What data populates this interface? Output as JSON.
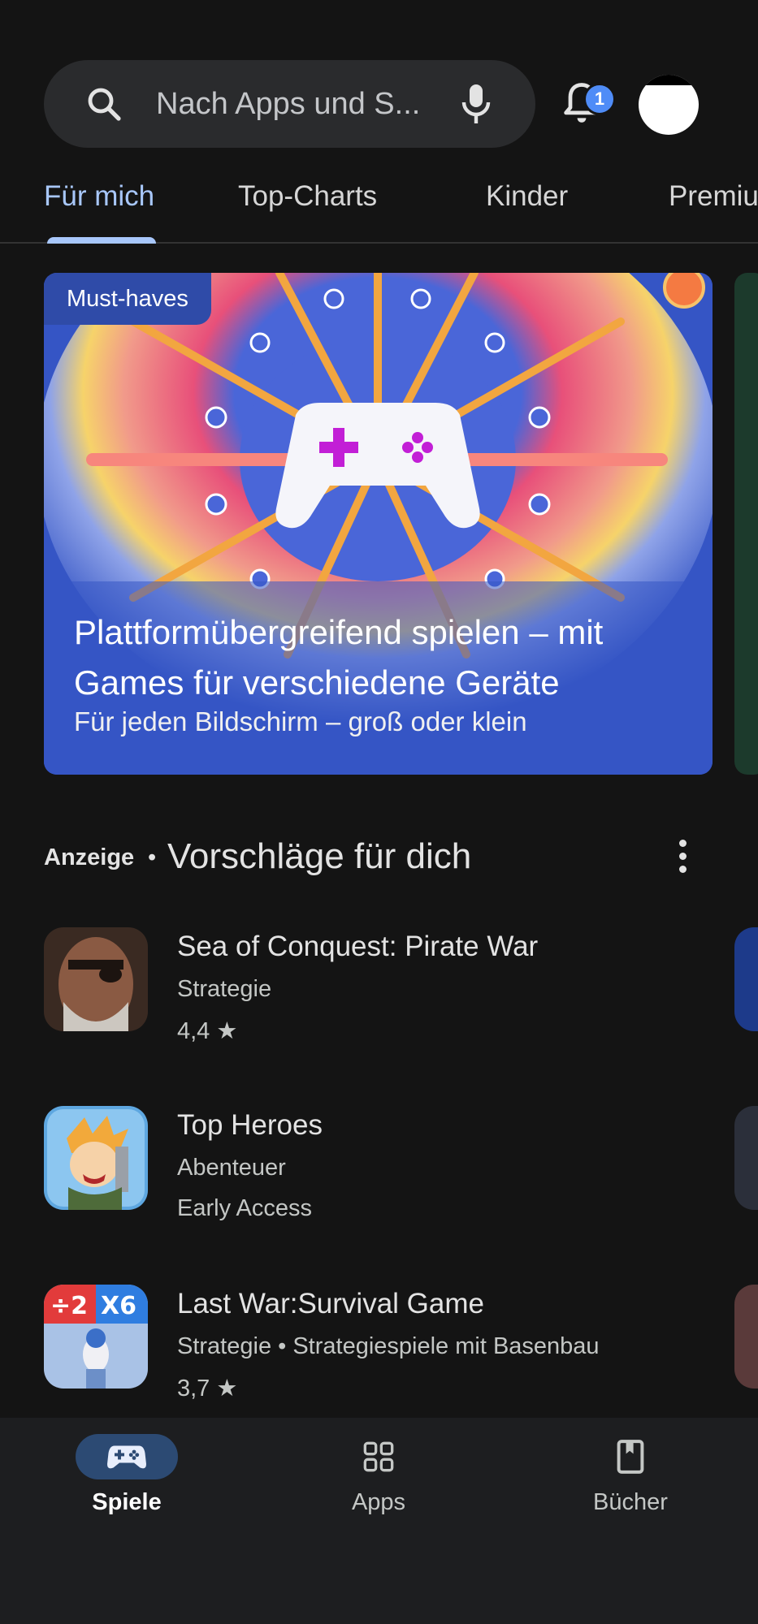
{
  "search": {
    "placeholder": "Nach Apps und S..."
  },
  "notifications": {
    "count": "1"
  },
  "tabs": [
    {
      "label": "Für mich",
      "active": true
    },
    {
      "label": "Top-Charts"
    },
    {
      "label": "Kinder"
    },
    {
      "label": "Premiu"
    }
  ],
  "hero": {
    "tag": "Must-haves",
    "title": "Plattformübergreifend spielen – mit Games für verschiedene Geräte",
    "subtitle": "Für jeden Bildschirm – groß oder klein"
  },
  "section": {
    "ad_label": "Anzeige",
    "separator": "•",
    "title": "Vorschläge für dich"
  },
  "apps": [
    {
      "name": "Sea of Conquest: Pirate War",
      "category": "Strategie",
      "line2": "4,4 ★"
    },
    {
      "name": "Top Heroes",
      "category": "Abenteuer",
      "line2": "Early Access"
    },
    {
      "name": "Last War:Survival Game",
      "category": "Strategie  •  Strategiespiele mit Basenbau",
      "line2": "3,7 ★"
    }
  ],
  "bottom_nav": [
    {
      "label": "Spiele",
      "icon": "gamepad-icon",
      "active": true
    },
    {
      "label": "Apps",
      "icon": "apps-grid-icon"
    },
    {
      "label": "Bücher",
      "icon": "book-icon"
    }
  ],
  "colors": {
    "background": "#141414",
    "accent": "#a8c7fa",
    "hero_bg": "#3555c5",
    "badge": "#4f8cf7"
  }
}
